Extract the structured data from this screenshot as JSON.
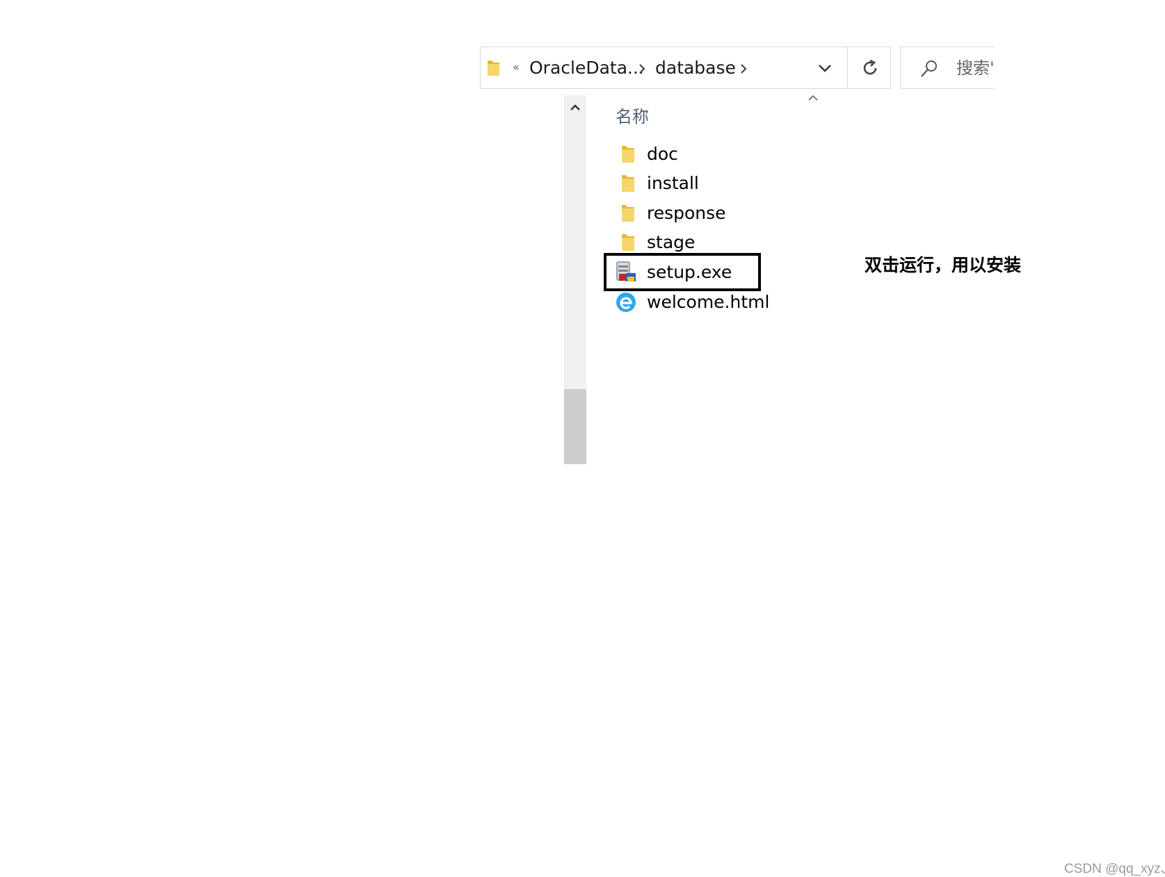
{
  "address_bar": {
    "overflow_indicator": "«",
    "breadcrumbs": [
      "OracleData...",
      "database"
    ],
    "refresh_glyph": "↻"
  },
  "search": {
    "placeholder": "搜索'"
  },
  "file_list": {
    "column_header": "名称",
    "items": [
      {
        "name": "doc",
        "icon": "folder-icon"
      },
      {
        "name": "install",
        "icon": "folder-icon"
      },
      {
        "name": "response",
        "icon": "folder-icon"
      },
      {
        "name": "stage",
        "icon": "folder-icon"
      },
      {
        "name": "setup.exe",
        "icon": "installer-icon"
      },
      {
        "name": "welcome.html",
        "icon": "edge-html-icon"
      }
    ]
  },
  "annotation": {
    "text": "双击运行，用以安装"
  },
  "watermark": "CSDN @qq_xyz、",
  "colors": {
    "folder": "#f6c94c",
    "border": "#d9d9d9",
    "header_text": "#4c607a",
    "scroll_track": "#f0f0f0",
    "scroll_thumb": "#cdcdcd"
  }
}
